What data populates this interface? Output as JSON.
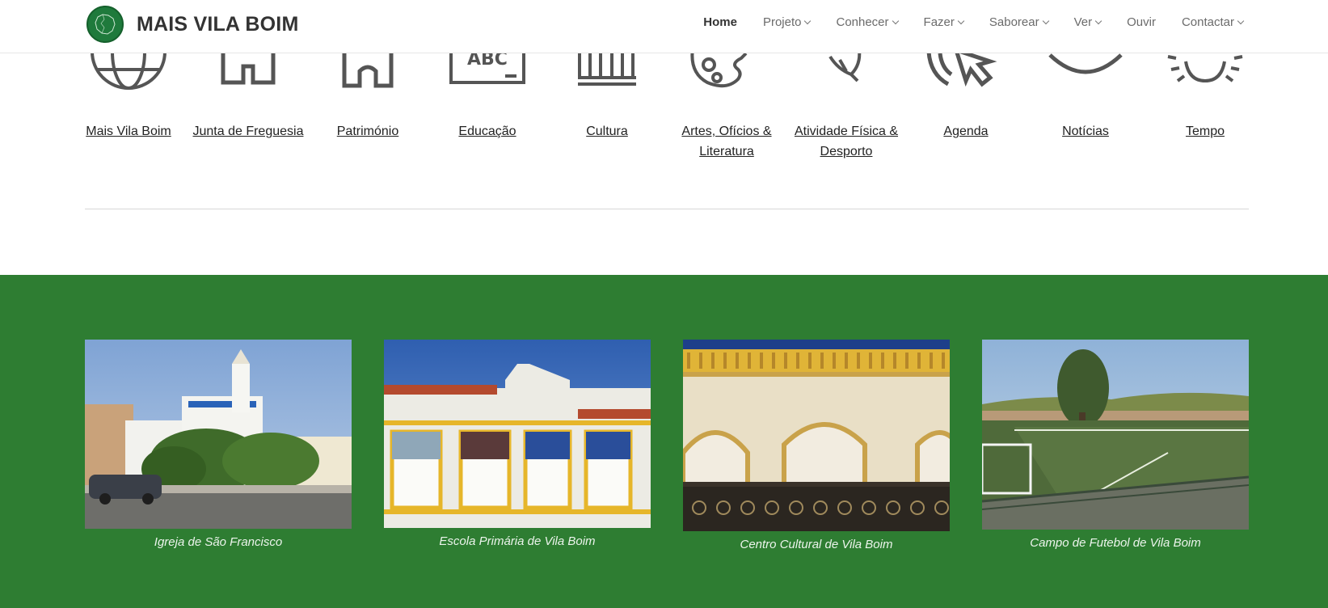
{
  "header": {
    "site_title": "MAIS VILA BOIM",
    "logo_icon": "map-logo-icon",
    "nav": [
      {
        "label": "Home",
        "active": true,
        "dropdown": false
      },
      {
        "label": "Projeto",
        "active": false,
        "dropdown": true
      },
      {
        "label": "Conhecer",
        "active": false,
        "dropdown": true
      },
      {
        "label": "Fazer",
        "active": false,
        "dropdown": true
      },
      {
        "label": "Saborear",
        "active": false,
        "dropdown": true
      },
      {
        "label": "Ver",
        "active": false,
        "dropdown": true
      },
      {
        "label": "Ouvir",
        "active": false,
        "dropdown": false
      },
      {
        "label": "Contactar",
        "active": false,
        "dropdown": true
      }
    ]
  },
  "categories": [
    {
      "label": "Mais Vila Boim",
      "icon": "globe-icon"
    },
    {
      "label": "Junta de Freguesia",
      "icon": "town-hall-icon"
    },
    {
      "label": "Património",
      "icon": "church-icon"
    },
    {
      "label": "Educação",
      "icon": "blackboard-icon"
    },
    {
      "label": "Cultura",
      "icon": "columns-icon"
    },
    {
      "label": "Artes, Ofícios & Literatura",
      "icon": "palette-icon"
    },
    {
      "label": "Atividade Física & Desporto",
      "icon": "leaf-icon"
    },
    {
      "label": "Agenda",
      "icon": "cursor-click-icon"
    },
    {
      "label": "Notícias",
      "icon": "eye-icon"
    },
    {
      "label": "Tempo",
      "icon": "sun-icon"
    }
  ],
  "gallery": [
    {
      "caption": "Igreja de São Francisco",
      "image": "church-photo"
    },
    {
      "caption": "Escola Primária de Vila Boim",
      "image": "school-photo"
    },
    {
      "caption": "Centro Cultural de Vila Boim",
      "image": "balcony-photo"
    },
    {
      "caption": "Campo de Futebol de Vila Boim",
      "image": "football-field-photo"
    }
  ],
  "colors": {
    "brand_green": "#2e7d32",
    "logo_green": "#1f7a3c",
    "icon_stroke": "#555555"
  }
}
